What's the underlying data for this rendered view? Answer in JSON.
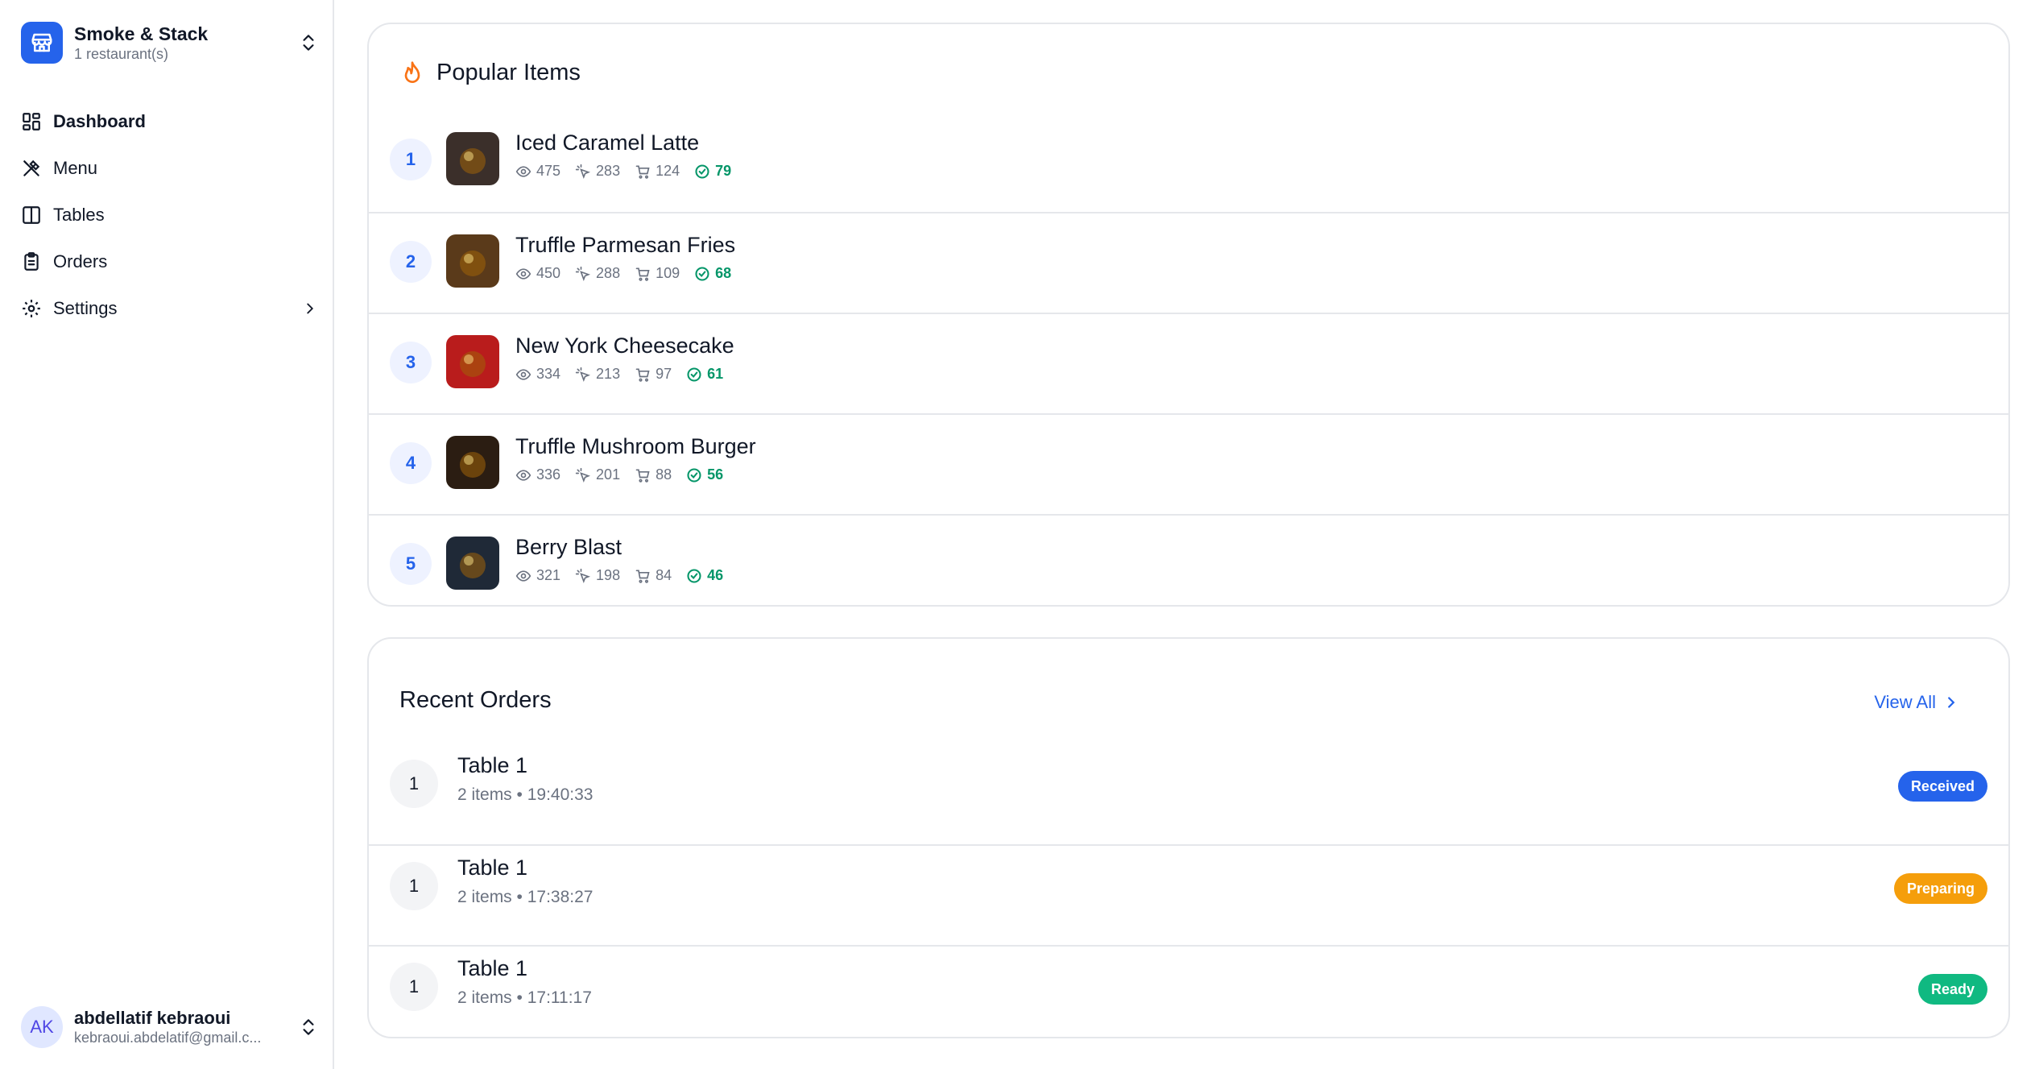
{
  "brand": {
    "name": "Smoke & Stack",
    "subtitle": "1 restaurant(s)"
  },
  "nav": [
    {
      "label": "Dashboard",
      "icon": "dashboard-icon",
      "active": true
    },
    {
      "label": "Menu",
      "icon": "utensils-icon"
    },
    {
      "label": "Tables",
      "icon": "tables-icon"
    },
    {
      "label": "Orders",
      "icon": "clipboard-icon"
    },
    {
      "label": "Settings",
      "icon": "gear-icon"
    }
  ],
  "user": {
    "initials": "AK",
    "name": "abdellatif kebraoui",
    "email": "kebraoui.abdelatif@gmail.c..."
  },
  "popular": {
    "title": "Popular Items",
    "items": [
      {
        "rank": "1",
        "name": "Iced Caramel Latte",
        "views": "475",
        "clicks": "283",
        "carts": "124",
        "orders": "79",
        "thumb_color": "#3b2f2a"
      },
      {
        "rank": "2",
        "name": "Truffle Parmesan Fries",
        "views": "450",
        "clicks": "288",
        "carts": "109",
        "orders": "68",
        "thumb_color": "#5a3a1a"
      },
      {
        "rank": "3",
        "name": "New York Cheesecake",
        "views": "334",
        "clicks": "213",
        "carts": "97",
        "orders": "61",
        "thumb_color": "#b91c1c"
      },
      {
        "rank": "4",
        "name": "Truffle Mushroom Burger",
        "views": "336",
        "clicks": "201",
        "carts": "88",
        "orders": "56",
        "thumb_color": "#2b1d12"
      },
      {
        "rank": "5",
        "name": "Berry Blast",
        "views": "321",
        "clicks": "198",
        "carts": "84",
        "orders": "46",
        "thumb_color": "#1f2937"
      }
    ]
  },
  "orders": {
    "title": "Recent Orders",
    "view_all": "View All",
    "items": [
      {
        "num": "1",
        "table": "Table 1",
        "meta": "2 items • 19:40:33",
        "status": "Received"
      },
      {
        "num": "1",
        "table": "Table 1",
        "meta": "2 items • 17:38:27",
        "status": "Preparing"
      },
      {
        "num": "1",
        "table": "Table 1",
        "meta": "2 items • 17:11:17",
        "status": "Ready"
      }
    ]
  },
  "colors": {
    "accent": "#2563eb",
    "received": "#2563eb",
    "preparing": "#f59e0b",
    "ready": "#10b981",
    "flame": "#f97316"
  }
}
